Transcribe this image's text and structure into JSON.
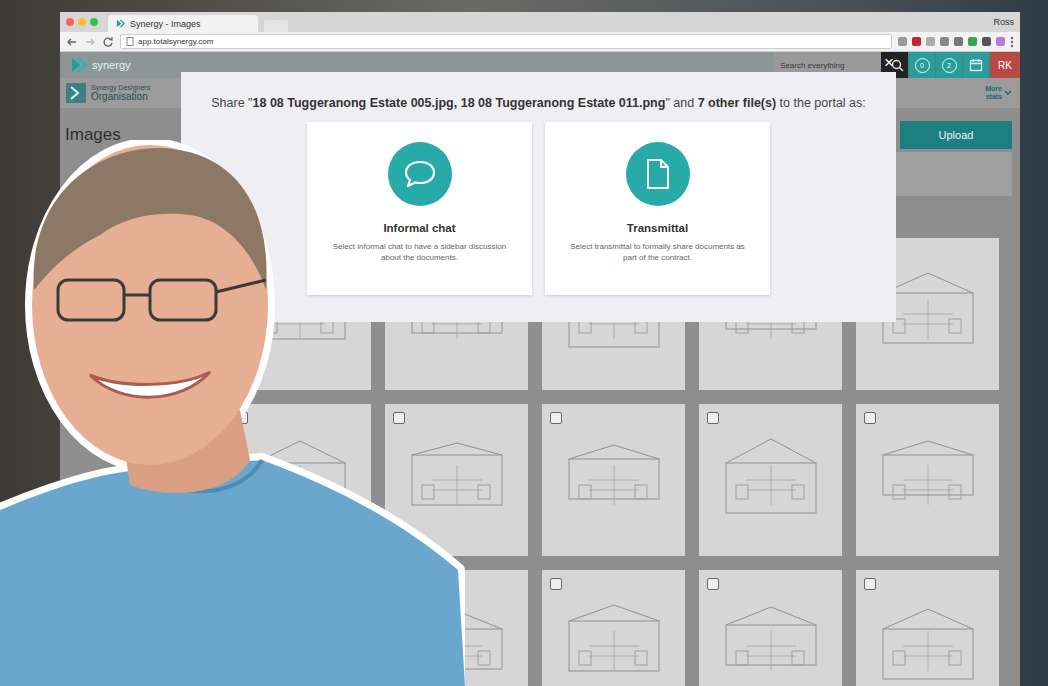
{
  "browser": {
    "tab_title": "Synergy - Images",
    "user": "Ross",
    "url": "app.totalsynergy.com"
  },
  "app": {
    "logo": "synergy",
    "search_placeholder": "Search everything",
    "counters": [
      {
        "count": "0"
      },
      {
        "count": "2"
      }
    ],
    "avatar": "RK",
    "org_top": "Synergy Designers",
    "org_bottom": "Organisation",
    "more_stats": "More stats"
  },
  "page": {
    "title": "Images",
    "upload_button": "Upload"
  },
  "thumbnails": [
    {
      "checked": false
    },
    {
      "checked": false
    },
    {
      "checked": false
    },
    {
      "checked": false
    },
    {
      "checked": false
    },
    {
      "checked": false
    },
    {
      "checked": false
    },
    {
      "checked": false
    },
    {
      "checked": false
    },
    {
      "checked": false
    },
    {
      "checked": false
    },
    {
      "checked": false
    },
    {
      "checked": false
    },
    {
      "checked": false
    },
    {
      "checked": false
    }
  ],
  "modal": {
    "prefix": "Share \"",
    "files": "18 08 Tuggeranong Estate 005.jpg, 18 08 Tuggeranong Estate 011.png",
    "middle": "\" and ",
    "count": "7 other file(s)",
    "suffix": " to the portal as:",
    "close": "×",
    "options": [
      {
        "kind": "chat",
        "title": "Informal chat",
        "description": "Select informal chat to have a sidebar discussion about the documents."
      },
      {
        "kind": "document",
        "title": "Transmittal",
        "description": "Select transmittal to formally share documents as part of the contract."
      }
    ]
  }
}
